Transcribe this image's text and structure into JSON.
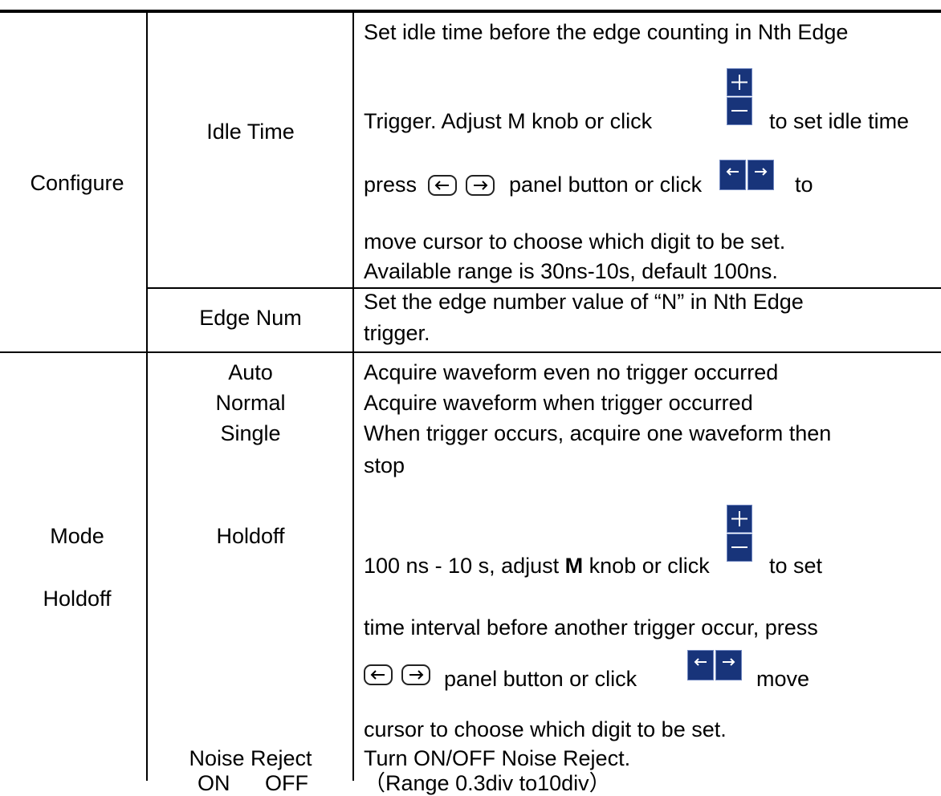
{
  "rows": {
    "configure": {
      "group": "Configure",
      "idle_time": {
        "label": "Idle Time",
        "lines": [
          "Set idle time before the edge counting in Nth Edge",
          "Trigger. Adjust M knob or click",
          "to set idle time",
          "press",
          "panel button or click",
          "to",
          "move cursor to choose which digit to be set.",
          "Available range is 30ns-10s, default 100ns."
        ]
      },
      "edge_num": {
        "label": "Edge Num",
        "lines": [
          "Set the edge number value of “N” in Nth Edge",
          "trigger."
        ]
      }
    },
    "mode_holdoff": {
      "group_mode": "Mode",
      "group_holdoff": "Holdoff",
      "auto": {
        "label": "Auto",
        "desc": "Acquire waveform even no trigger occurred"
      },
      "normal": {
        "label": "Normal",
        "desc": "Acquire waveform when trigger occurred"
      },
      "single": {
        "label": "Single",
        "desc": [
          "When trigger occurs, acquire one waveform then",
          "stop"
        ]
      },
      "holdoff": {
        "label": "Holdoff",
        "line1_a": "100 ns - 10 s, adjust ",
        "line1_bold": "M",
        "line1_b": " knob or click",
        "line1_c": "to set",
        "line2": "time interval before another trigger occur, press",
        "line3_a": "panel button or click",
        "line3_b": "move",
        "line4": "cursor to choose which digit to be set."
      },
      "noise_reject": {
        "label": "Noise Reject",
        "on": "ON",
        "off": "OFF",
        "desc1": "Turn ON/OFF Noise Reject.",
        "desc2": "（Range 0.3div to10div）"
      }
    }
  },
  "icons": [
    "plus-minus-button-icon",
    "left-right-arrow-button-icon",
    "left-arrow-key-icon",
    "right-arrow-key-icon"
  ],
  "colors": {
    "button_blue": "#18347a",
    "button_border": "#6f86c0",
    "text": "#000000"
  }
}
